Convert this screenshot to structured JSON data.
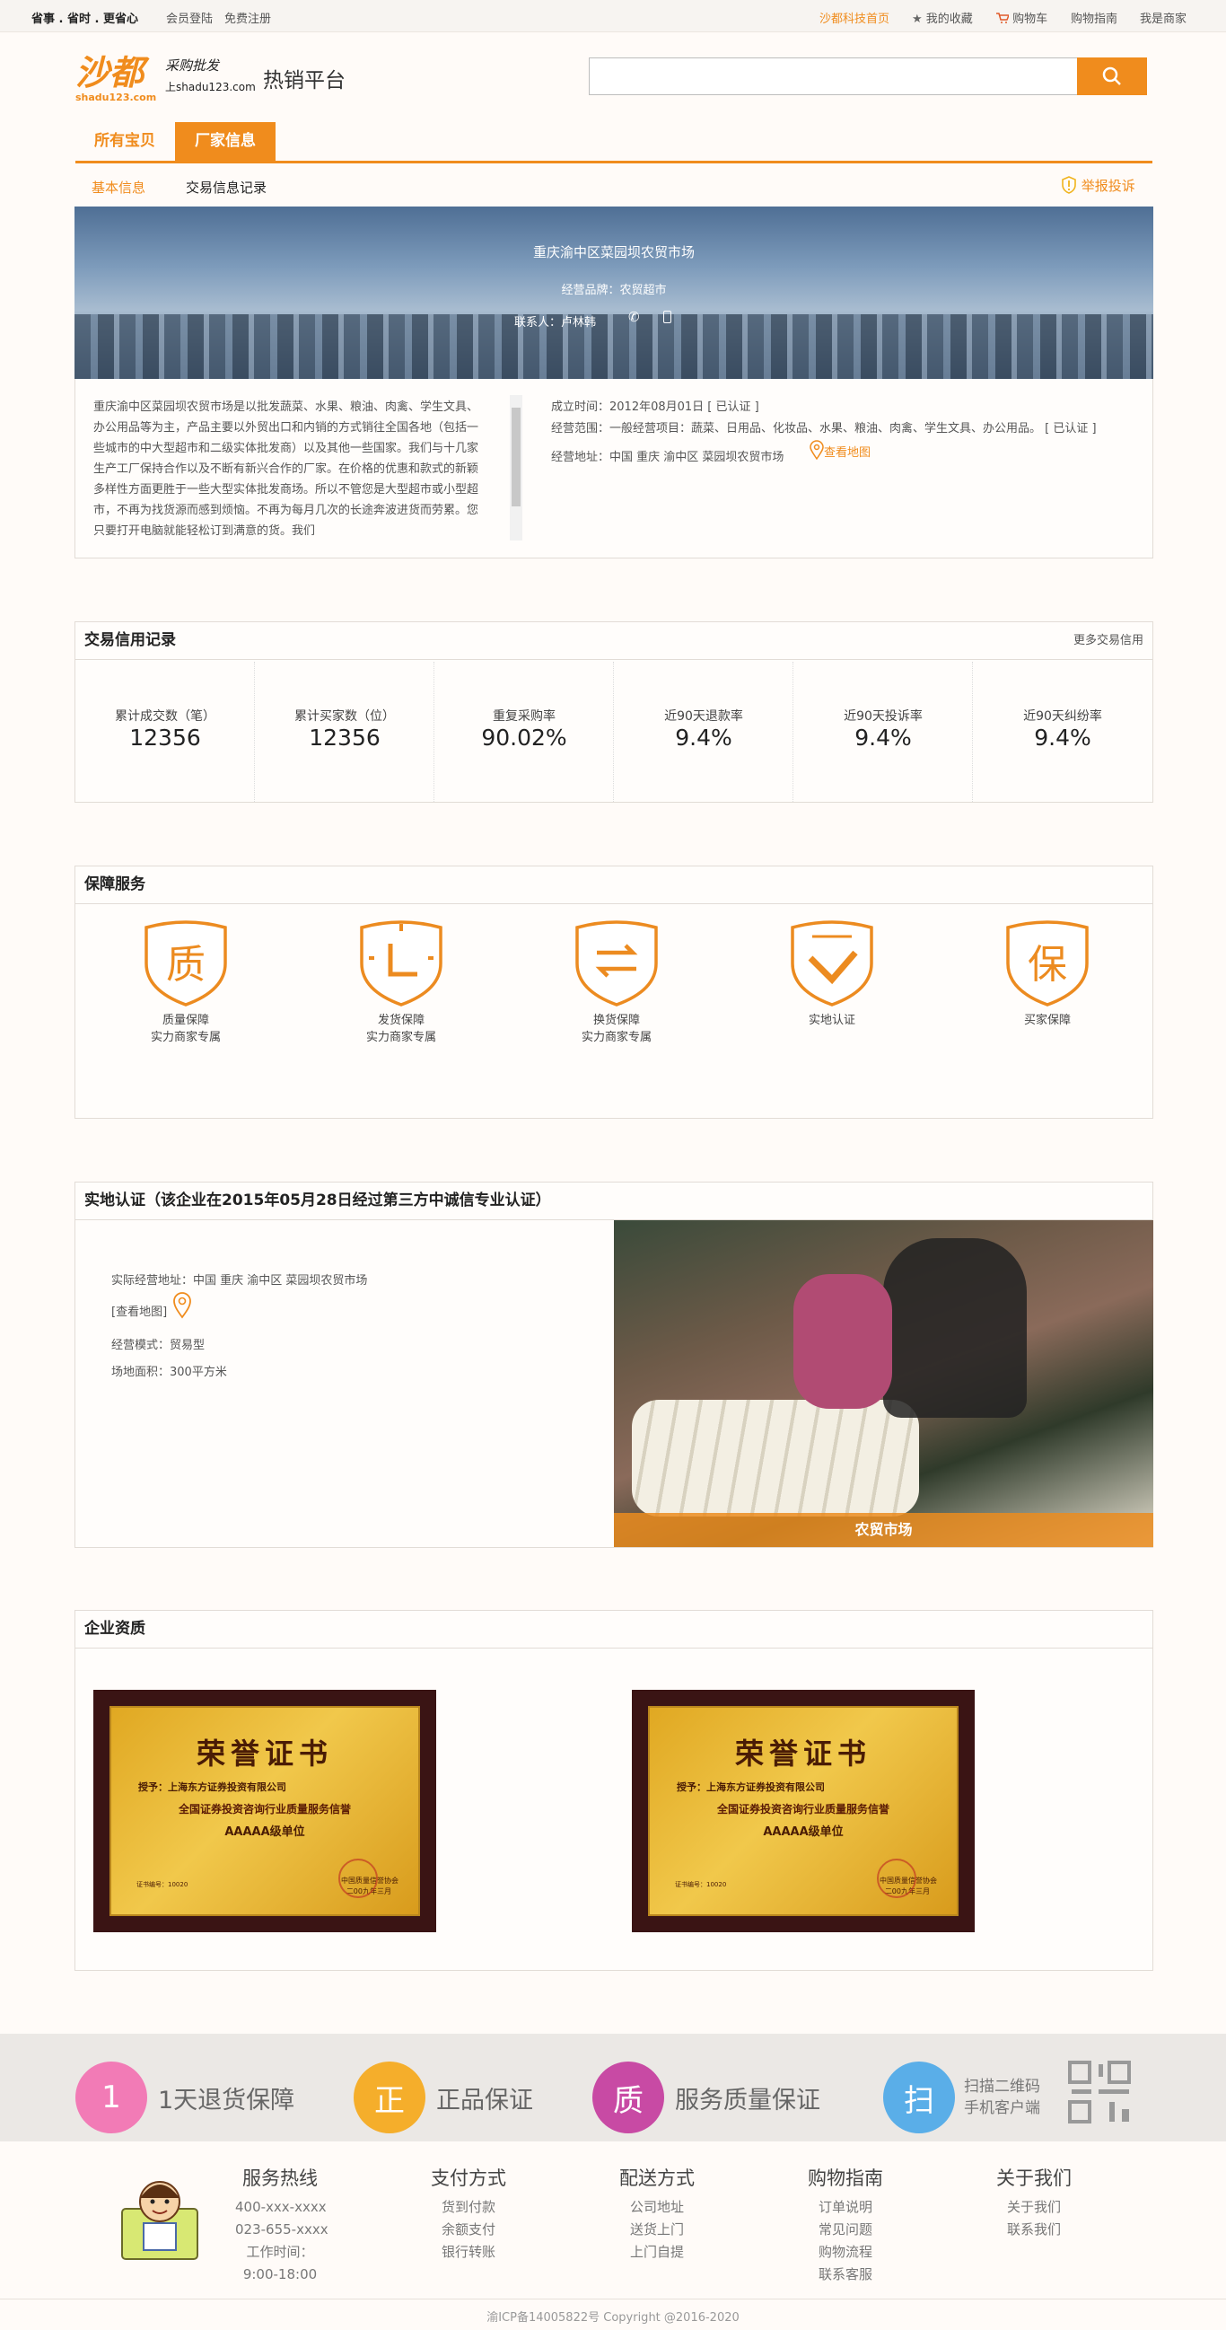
{
  "topbar": {
    "slogan": "省事 . 省时 . 更省心",
    "login": "会员登陆",
    "register": "免费注册",
    "home": "沙都科技首页",
    "favorites": "我的收藏",
    "cart": "购物车",
    "guide": "购物指南",
    "merchant": "我是商家"
  },
  "logo": {
    "brand": "沙都",
    "sub": "采购批发",
    "url1": "shadu123.com",
    "url2": "上shadu123.com",
    "platform": "热销平台"
  },
  "search": {
    "placeholder": ""
  },
  "tabs": [
    "所有宝贝",
    "厂家信息"
  ],
  "subnav": {
    "basic": "基本信息",
    "records": "交易信息记录",
    "report": "举报投诉"
  },
  "banner": {
    "name": "重庆渝中区菜园坝农贸市场",
    "brand": "经营品牌：农贸超市",
    "contact": "联系人：卢林韩"
  },
  "intro": "重庆渝中区菜园坝农贸市场是以批发蔬菜、水果、粮油、肉禽、学生文具、办公用品等为主，产品主要以外贸出口和内销的方式销往全国各地（包括一些城市的中大型超市和二级实体批发商）以及其他一些国家。我们与十几家生产工厂保持合作以及不断有新兴合作的厂家。在价格的优惠和款式的新颖多样性方面更胜于一些大型实体批发商场。所以不管您是大型超市或小型超市，不再为找货源而感到烦恼。不再为每月几次的长途奔波进货而劳累。您只要打开电脑就能轻松订到满意的货。我们",
  "company": {
    "established": "成立时间：2012年08月01日 [ 已认证 ]",
    "scope": "经营范围：一般经营项目：蔬菜、日用品、化妆品、水果、粮油、肉禽、学生文具、办公用品。 [ 已认证 ]",
    "address": "经营地址：中国 重庆 渝中区 菜园坝农贸市场",
    "map": "查看地图"
  },
  "credit": {
    "title": "交易信用记录",
    "more": "更多交易信用",
    "stats": [
      {
        "label": "累计成交数（笔）",
        "value": "12356"
      },
      {
        "label": "累计买家数（位）",
        "value": "12356"
      },
      {
        "label": "重复采购率",
        "value": "90.02%"
      },
      {
        "label": "近90天退款率",
        "value": "9.4%"
      },
      {
        "label": "近90天投诉率",
        "value": "9.4%"
      },
      {
        "label": "近90天纠纷率",
        "value": "9.4%"
      }
    ]
  },
  "services": {
    "title": "保障服务",
    "items": [
      {
        "glyph": "质",
        "line1": "质量保障",
        "line2": "实力商家专属"
      },
      {
        "glyph": "",
        "line1": "发货保障",
        "line2": "实力商家专属"
      },
      {
        "glyph": "",
        "line1": "换货保障",
        "line2": "实力商家专属"
      },
      {
        "glyph": "",
        "line1": "实地认证",
        "line2": ""
      },
      {
        "glyph": "保",
        "line1": "买家保障",
        "line2": ""
      }
    ]
  },
  "onsite": {
    "title": "实地认证（该企业在2015年05月28日经过第三方中诚信专业认证）",
    "address": "实际经营地址：中国 重庆 渝中区 菜园坝农贸市场",
    "map": "[查看地图]",
    "mode": "经营模式：贸易型",
    "area": "场地面积：300平方米",
    "photo_caption": "农贸市场"
  },
  "qualification": {
    "title": "企业资质",
    "certs": [
      {
        "heading": "荣誉证书",
        "to": "授予：上海东方证券投资有限公司",
        "body": "全国证券投资咨询行业质量服务信誉",
        "grade": "AAAAA级单位",
        "no": "证书编号：10020",
        "issuer": "中国质量信誉协会",
        "date": "二00九年三月"
      },
      {
        "heading": "荣誉证书",
        "to": "授予：上海东方证券投资有限公司",
        "body": "全国证券投资咨询行业质量服务信誉",
        "grade": "AAAAA级单位",
        "no": "证书编号：10020",
        "issuer": "中国质量信誉协会",
        "date": "二00九年三月"
      }
    ]
  },
  "promos": [
    {
      "glyph": "1",
      "text": "1天退货保障",
      "color": "#f27bb6"
    },
    {
      "glyph": "正",
      "text": "正品保证",
      "color": "#f5ae2b"
    },
    {
      "glyph": "质",
      "text": "服务质量保证",
      "color": "#c84aa4"
    },
    {
      "glyph": "扫",
      "text1": "扫描二维码",
      "text2": "手机客户端",
      "color": "#5aaee8"
    }
  ],
  "footer": {
    "cols": [
      {
        "head": "服务热线",
        "items": [
          "400-xxx-xxxx",
          "023-655-xxxx",
          "工作时间：",
          "9:00-18:00"
        ]
      },
      {
        "head": "支付方式",
        "items": [
          "货到付款",
          "余额支付",
          "银行转账"
        ]
      },
      {
        "head": "配送方式",
        "items": [
          "公司地址",
          "送货上门",
          "上门自提"
        ]
      },
      {
        "head": "购物指南",
        "items": [
          "订单说明",
          "常见问题",
          "购物流程",
          "联系客服"
        ]
      },
      {
        "head": "关于我们",
        "items": [
          "关于我们",
          "联系我们"
        ]
      }
    ],
    "copyright": "渝ICP备14005822号 Copyright @2016-2020"
  }
}
